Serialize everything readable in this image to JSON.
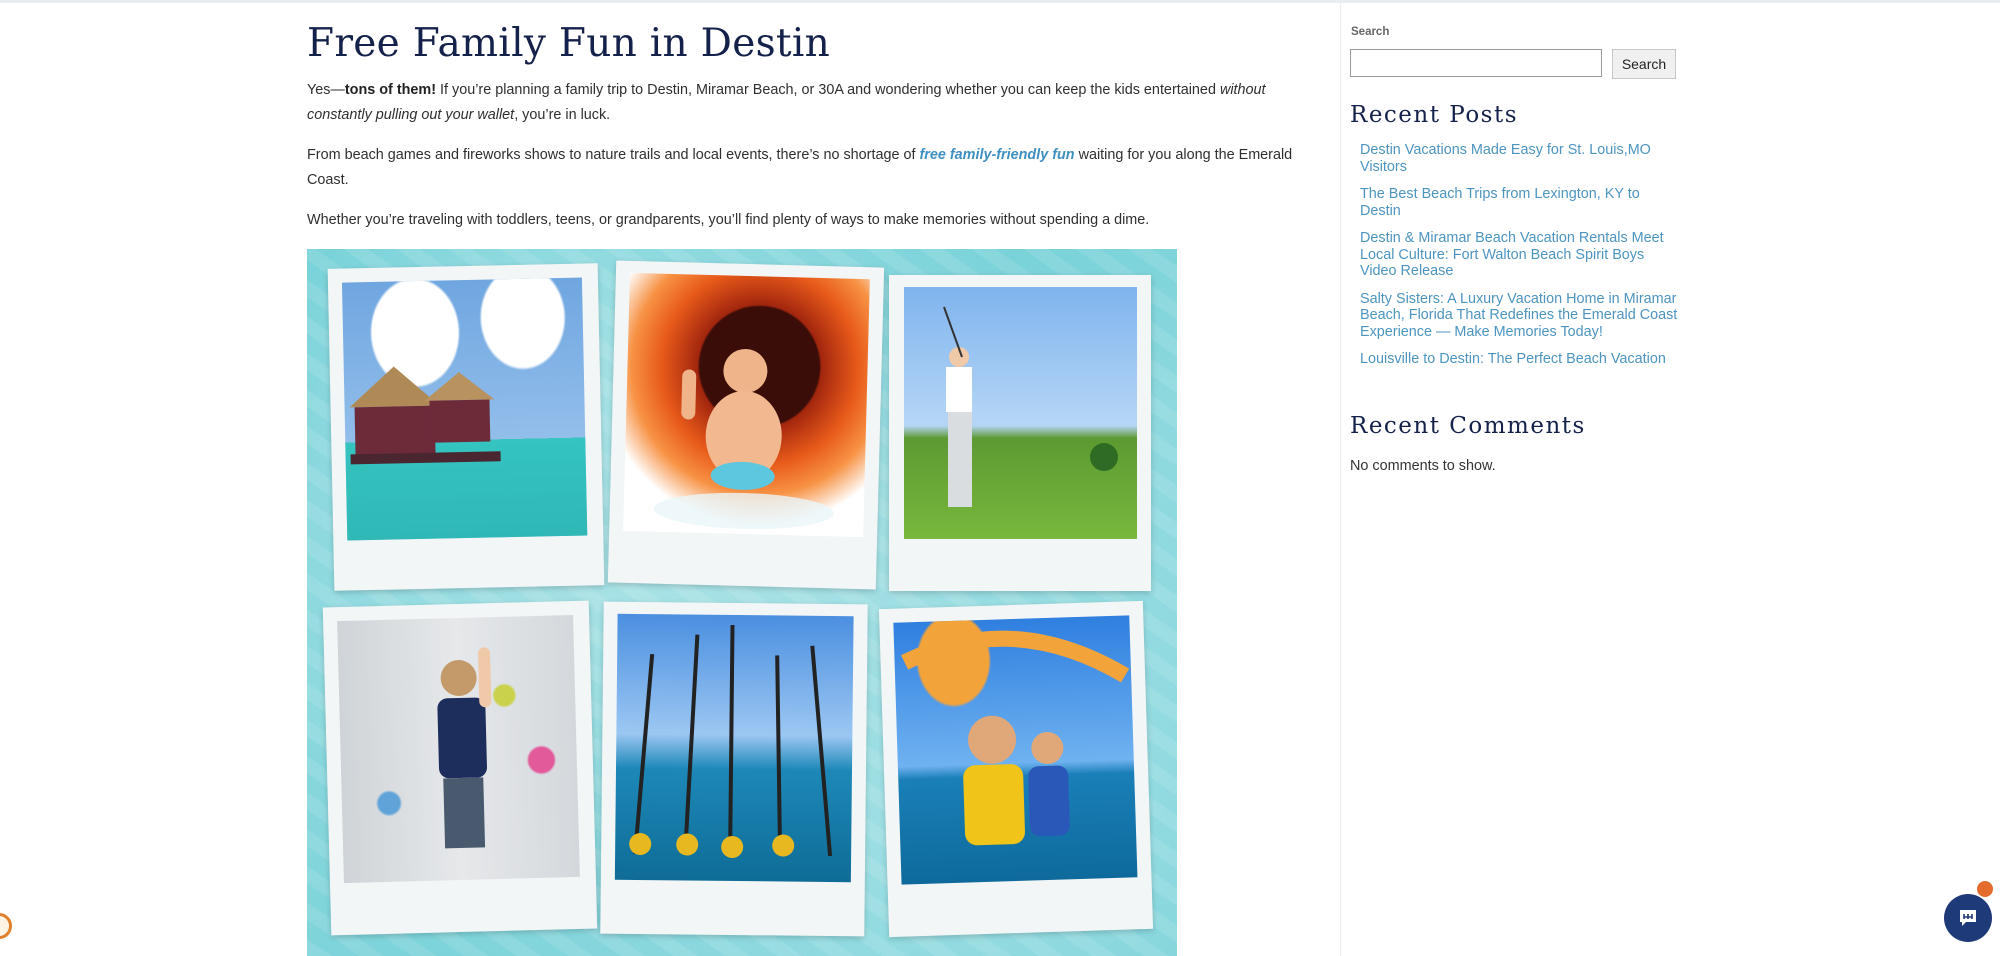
{
  "article": {
    "title": "Free Family Fun in Destin",
    "p1": {
      "lead": "Yes—",
      "bold": "tons of them!",
      "middle": " If you’re planning a family trip to Destin, Miramar Beach, or 30A and wondering whether you can keep the kids entertained ",
      "italic": "without constantly pulling out your wallet",
      "tail": ", you’re in luck."
    },
    "p2": {
      "lead": "From beach games and fireworks shows to nature trails and local events, there’s no shortage of ",
      "link": "free family-friendly fun",
      "tail": " waiting for you along the Emerald Coast."
    },
    "p3": "Whether you’re traveling with toddlers, teens, or grandparents, you’ll find plenty of ways to make memories without spending a dime."
  },
  "collage": {
    "photos": [
      "tiki boat on turquoise water",
      "boy on water slide giving thumbs up",
      "golfer swinging on green course",
      "girl on climbing wall",
      "fishing rods on boat deck",
      "parasailing couple"
    ]
  },
  "sidebar": {
    "search_label": "Search",
    "search_value": "",
    "search_button": "Search",
    "recent_posts_title": "Recent Posts",
    "recent_posts": [
      "Destin Vacations Made Easy for St. Louis,MO Visitors",
      "The Best Beach Trips from Lexington, KY to Destin",
      "Destin & Miramar Beach Vacation Rentals Meet Local Culture: Fort Walton Beach Spirit Boys Video Release",
      "Salty Sisters: A Luxury Vacation Home in Miramar Beach, Florida That Redefines the Emerald Coast Experience — Make Memories Today!",
      "Louisville to Destin: The Perfect Beach Vacation"
    ],
    "recent_comments_title": "Recent Comments",
    "no_comments": "No comments to show."
  },
  "widgets": {
    "chat_icon": "chat-bubble-icon",
    "cookie_icon": "cookie-icon",
    "accent": "#1f3a78",
    "badge_color": "#e36b2c"
  }
}
